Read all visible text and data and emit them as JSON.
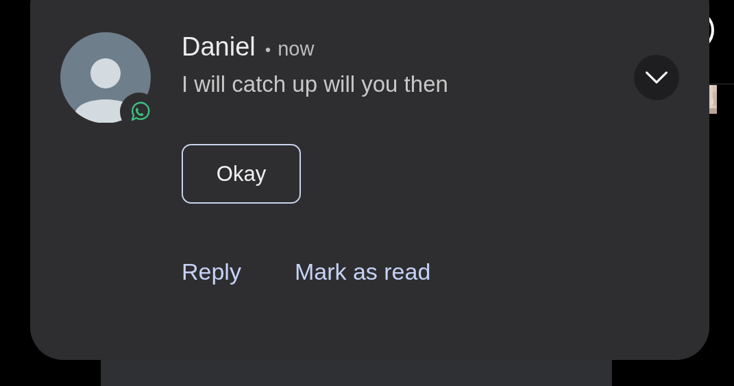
{
  "notification": {
    "sender": "Daniel",
    "separator": "•",
    "time": "now",
    "message": "I will catch up will you then",
    "expanded": false,
    "quick_replies": [
      "Okay"
    ],
    "actions": [
      "Reply",
      "Mark as read"
    ]
  }
}
